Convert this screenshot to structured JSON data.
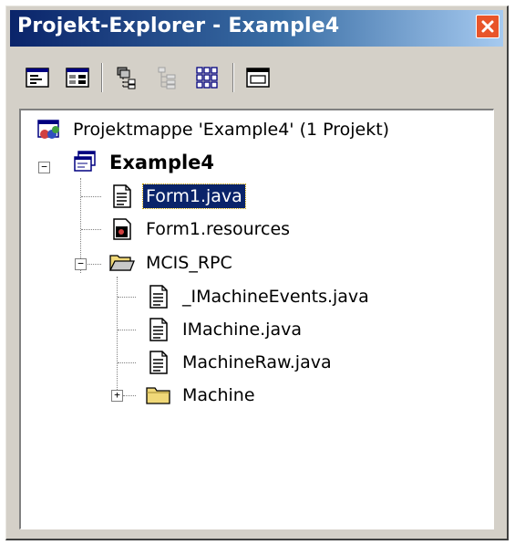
{
  "window": {
    "title": "Projekt-Explorer - Example4",
    "close_icon": "close-x-icon"
  },
  "toolbar": {
    "buttons": [
      {
        "name": "view-code-button",
        "icon": "view-code-icon"
      },
      {
        "name": "view-object-button",
        "icon": "view-designer-icon"
      },
      {
        "name": "show-all-files-button",
        "icon": "show-all-files-icon"
      },
      {
        "name": "hierarchy-button",
        "icon": "tree-hierarchy-icon"
      },
      {
        "name": "class-view-button",
        "icon": "grid-icon"
      },
      {
        "name": "properties-button",
        "icon": "window-icon"
      }
    ]
  },
  "tree": {
    "solution_label": "Projektmappe 'Example4' (1 Projekt)",
    "project_label": "Example4",
    "items": {
      "form1_java": "Form1.java",
      "form1_resources": "Form1.resources",
      "mcis_rpc": "MCIS_RPC",
      "imachineevents": "_IMachineEvents.java",
      "imachine": "IMachine.java",
      "machineraw": "MachineRaw.java",
      "machine": "Machine"
    },
    "selected": "Form1.java",
    "expander_collapsed": "+",
    "expander_expanded": "−"
  },
  "colors": {
    "title_start": "#0a246a",
    "title_end": "#a6caf0",
    "selection": "#0a246a",
    "folder": "#f0d878",
    "close": "#e8552a"
  }
}
